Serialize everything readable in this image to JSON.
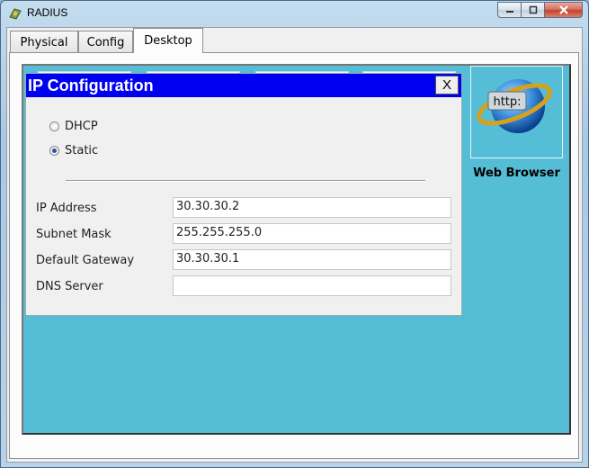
{
  "window": {
    "title": "RADIUS",
    "controls": {
      "minimize": "minimize",
      "maximize": "maximize",
      "close": "close"
    }
  },
  "tabs": [
    {
      "label": "Physical"
    },
    {
      "label": "Config"
    },
    {
      "label": "Desktop",
      "active": true
    }
  ],
  "dialog": {
    "title": "IP Configuration",
    "close_label": "X",
    "mode_options": [
      {
        "label": "DHCP",
        "checked": false
      },
      {
        "label": "Static",
        "checked": true
      }
    ],
    "fields": [
      {
        "label": "IP Address",
        "value": "30.30.30.2"
      },
      {
        "label": "Subnet Mask",
        "value": "255.255.255.0"
      },
      {
        "label": "Default Gateway",
        "value": "30.30.30.1"
      },
      {
        "label": "DNS Server",
        "value": ""
      }
    ]
  },
  "desktop_apps": [
    {
      "label": "Web Browser",
      "icon_text": "http:",
      "icon": "web-browser-icon"
    }
  ],
  "colors": {
    "desktop_bg": "#55bdd6",
    "dialog_titlebar": "#0000f0"
  }
}
